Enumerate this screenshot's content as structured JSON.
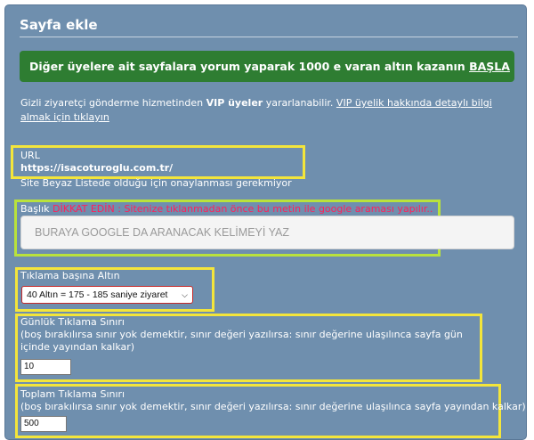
{
  "title": "Sayfa ekle",
  "promo": {
    "text": "Diğer üyelere ait sayfalara yorum yaparak 1000 e varan altın kazanın",
    "link": "BAŞLA"
  },
  "vip": {
    "prefix": "Gizli ziyaretçi gönderme hizmetinden ",
    "bold": "VIP üyeler",
    "middle": " yararlanabilir. ",
    "link": "VIP üyelik hakkında detaylı bilgi almak için tıklayın"
  },
  "url": {
    "label": "URL",
    "value": "https://isacoturoglu.com.tr/",
    "note": "Site Beyaz Listede olduğu için onaylanması gerekmiyor"
  },
  "baslik": {
    "label": "Başlık",
    "warning": "DİKKAT EDİN : Sitenize tıklanmadan önce bu metin ile google araması yapılır..",
    "placeholder": "BURAYA GOOGLE DA ARANACAK KELİMEYİ YAZ"
  },
  "tiklama": {
    "label": "Tıklama başına Altın",
    "selected": "40 Altın = 175 - 185 saniye ziyaret"
  },
  "gunluk": {
    "label": "Günlük Tıklama Sınırı",
    "help": "(boş bırakılırsa sınır yok demektir, sınır değeri yazılırsa: sınır değerine ulaşılınca sayfa gün içinde yayından kalkar)",
    "value": "10"
  },
  "toplam": {
    "label": "Toplam Tıklama Sınırı",
    "help": "(boş bırakılırsa sınır yok demektir, sınır değeri yazılırsa: sınır değerine ulaşılınca sayfa yayından kalkar)",
    "value": "500"
  },
  "colors": {
    "panel": "#6f8fae",
    "promo": "#2e7d32",
    "highlight_yellow": "#f3e53b",
    "highlight_green": "#b9e23c",
    "warning": "#ff1f5a"
  },
  "icons": {
    "select_arrow": "chevron-down-icon"
  }
}
